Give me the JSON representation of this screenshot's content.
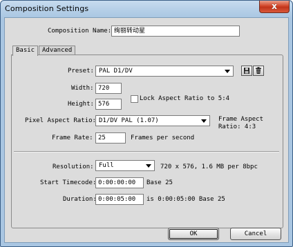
{
  "window": {
    "title": "Composition Settings",
    "close_glyph": "x"
  },
  "composition_name": {
    "label": "Composition Name:",
    "value": "绚丽转动星"
  },
  "tabs": [
    {
      "label": "Basic",
      "active": true
    },
    {
      "label": "Advanced",
      "active": false
    }
  ],
  "preset": {
    "label": "Preset:",
    "value": "PAL D1/DV",
    "save_icon": "floppy-disk-icon",
    "delete_icon": "trash-icon"
  },
  "width": {
    "label": "Width:",
    "value": "720"
  },
  "height": {
    "label": "Height:",
    "value": "576"
  },
  "lock_aspect": {
    "label": "Lock Aspect Ratio to 5:4",
    "checked": false
  },
  "pixel_aspect": {
    "label": "Pixel Aspect Ratio:",
    "value": "D1/DV PAL (1.07)",
    "frame_aspect_line1": "Frame Aspect",
    "frame_aspect_line2": "Ratio: 4:3"
  },
  "frame_rate": {
    "label": "Frame Rate:",
    "value": "25",
    "units": "Frames per second"
  },
  "resolution": {
    "label": "Resolution:",
    "value": "Full",
    "info": "720 x 576, 1.6 MB per 8bpc"
  },
  "start_timecode": {
    "label": "Start Timecode:",
    "value": "0:00:00:00",
    "base": "Base 25"
  },
  "duration": {
    "label": "Duration:",
    "value": "0:00:05:00",
    "info": "is 0:00:05:00  Base 25"
  },
  "buttons": {
    "ok": "OK",
    "cancel": "Cancel"
  },
  "colors": {
    "titlebar": "#b7d0e8",
    "client": "#dcdcdc",
    "close": "#c1351b"
  }
}
